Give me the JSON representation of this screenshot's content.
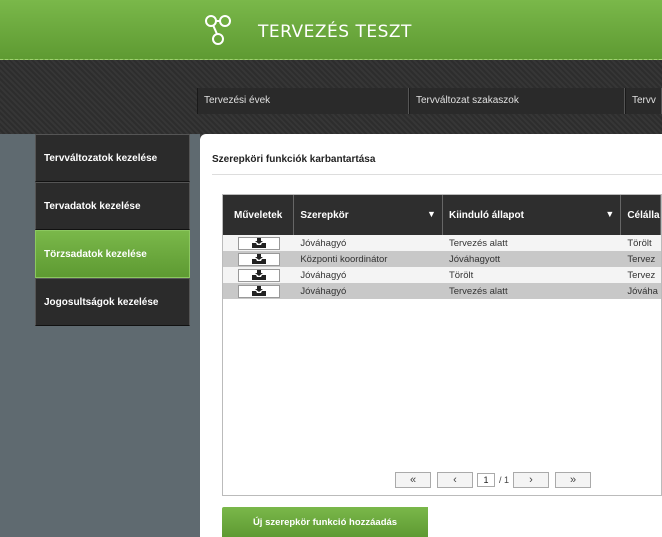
{
  "header": {
    "title": "TERVEZÉS TESZT",
    "logo_icon": "connected-nodes-icon"
  },
  "topnav": {
    "items": [
      "Tervezési évek",
      "Tervváltozat szakaszok",
      "Tervv"
    ]
  },
  "sidebar": {
    "items": [
      {
        "label": "Tervváltozatok kezelése",
        "active": false
      },
      {
        "label": "Tervadatok kezelése",
        "active": false
      },
      {
        "label": "Törzsadatok kezelése",
        "active": true
      },
      {
        "label": "Jogosultságok kezelése",
        "active": false
      }
    ]
  },
  "panel": {
    "title": "Szerepköri funkciók karbantartása"
  },
  "table": {
    "columns": [
      "Műveletek",
      "Szerepkör",
      "Kiinduló állapot",
      "Célállap"
    ],
    "rows": [
      {
        "szerepkor": "Jóváhagyó",
        "kiindulo": "Tervezés alatt",
        "cel": "Törölt"
      },
      {
        "szerepkor": "Központi koordinátor",
        "kiindulo": "Jóváhagyott",
        "cel": "Tervez"
      },
      {
        "szerepkor": "Jóváhagyó",
        "kiindulo": "Törölt",
        "cel": "Tervez"
      },
      {
        "szerepkor": "Jóváhagyó",
        "kiindulo": "Tervezés alatt",
        "cel": "Jóváha"
      }
    ],
    "action_icon": "inbox-tray-icon",
    "filter_icon": "filter-icon"
  },
  "pager": {
    "first": "«",
    "prev": "‹",
    "next": "›",
    "last": "»",
    "page": "1",
    "total": "/ 1"
  },
  "add_button": {
    "label": "Új szerepkör funkció hozzáadás"
  },
  "colors": {
    "accent": "#6aa83c",
    "dark": "#2e2e2e",
    "sidebar_bg": "#5f6a70"
  }
}
